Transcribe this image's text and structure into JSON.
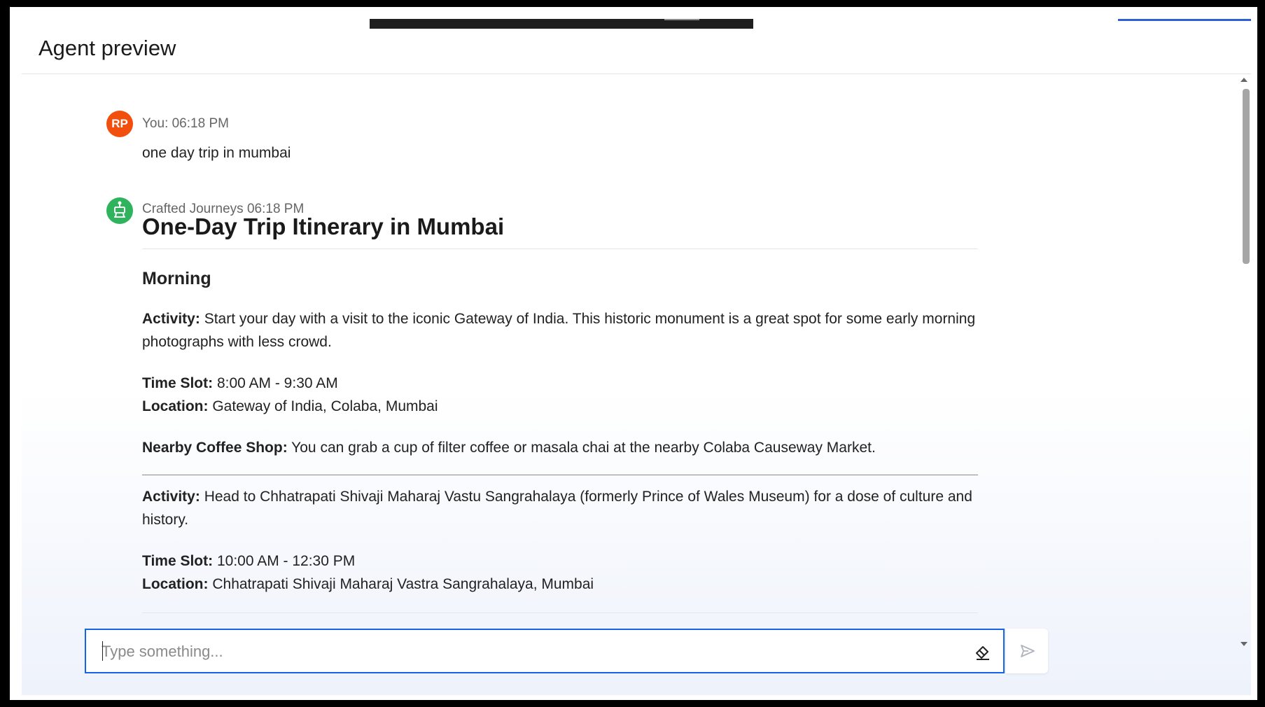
{
  "header": {
    "title": "Agent preview"
  },
  "messages": {
    "user": {
      "initials": "RP",
      "meta": "You: 06:18 PM",
      "text": "one day trip in mumbai"
    },
    "bot": {
      "meta": "Crafted Journeys 06:18 PM",
      "title": "One-Day Trip Itinerary in Mumbai",
      "section": "Morning",
      "activity1_label": "Activity:",
      "activity1_text": "Start your day with a visit to the iconic Gateway of India. This historic monument is a great spot for some early morning photographs with less crowd.",
      "timeslot1_label": "Time Slot:",
      "timeslot1_text": "8:00 AM - 9:30 AM",
      "location1_label": "Location:",
      "location1_text": "Gateway of India, Colaba, Mumbai",
      "coffee_label": "Nearby Coffee Shop:",
      "coffee_text": "You can grab a cup of filter coffee or masala chai at the nearby Colaba Causeway Market.",
      "activity2_label": "Activity:",
      "activity2_text": "Head to Chhatrapati Shivaji Maharaj Vastu Sangrahalaya (formerly Prince of Wales Museum) for a dose of culture and history.",
      "timeslot2_label": "Time Slot:",
      "timeslot2_text": "10:00 AM - 12:30 PM",
      "location2_label": "Location:",
      "location2_text": "Chhatrapati Shivaji Maharaj Vastra Sangrahalaya, Mumbai"
    }
  },
  "composer": {
    "placeholder": "Type something...",
    "value": "",
    "clear_icon": "eraser-icon",
    "send_icon": "send-icon"
  },
  "colors": {
    "user_avatar": "#f24e0d",
    "bot_avatar": "#2fb35c",
    "input_focus": "#1662e8"
  }
}
